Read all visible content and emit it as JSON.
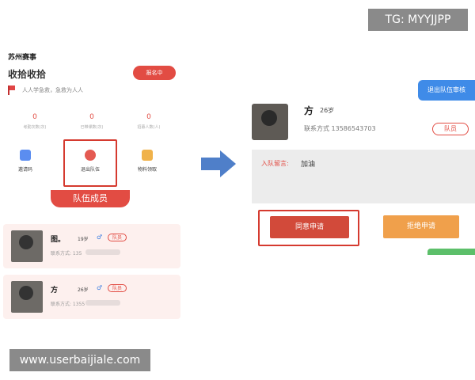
{
  "badges": {
    "telegram": "TG: MYYJJPP",
    "website": "www.userbaijiale.com"
  },
  "left_screen": {
    "title": "苏州赛事",
    "team_name": "收拾收拾",
    "apply_button": "报名中",
    "slogan": "人人学急救，急救为人人",
    "stats": [
      {
        "value": "0",
        "label": "考勤次数(次)"
      },
      {
        "value": "0",
        "label": "已带课数(次)"
      },
      {
        "value": "0",
        "label": "招募人数(人)"
      }
    ],
    "tools": [
      {
        "label": "邀请码",
        "icon": "qr-code-icon"
      },
      {
        "label": "退出队伍",
        "icon": "exit-icon"
      },
      {
        "label": "物料领取",
        "icon": "material-icon"
      }
    ],
    "members_tab": "队伍成员",
    "members": [
      {
        "name": "图。",
        "age": "19岁",
        "gender": "♂",
        "role": "队员",
        "contact_label": "联系方式: 135"
      },
      {
        "name": "方",
        "age": "26岁",
        "gender": "♂",
        "role": "队员",
        "contact_label": "联系方式: 1355"
      }
    ]
  },
  "right_screen": {
    "exit_review_button": "退出队伍审核",
    "name": "方",
    "age": "26岁",
    "contact": "联系方式  13586543703",
    "role": "队员",
    "message_label": "入队留言:",
    "message_value": "加油",
    "agree_button": "同意申请",
    "reject_button": "拒绝申请"
  },
  "colors": {
    "accent_red": "#e24c43",
    "blue": "#3f8be8",
    "orange": "#f0a04b",
    "arrow": "#4f7fc9"
  }
}
